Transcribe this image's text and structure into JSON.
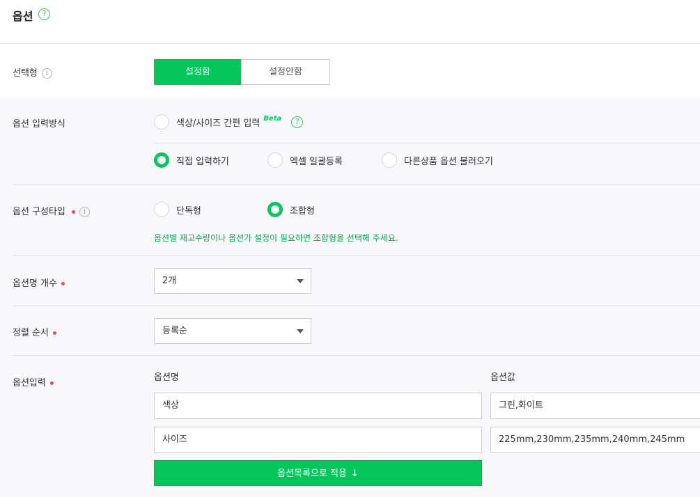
{
  "header": {
    "title": "옵션",
    "help_glyph": "?"
  },
  "selection_type": {
    "label": "선택형",
    "info_glyph": "i",
    "options": [
      "설정함",
      "설정안함"
    ],
    "selected": "설정함"
  },
  "input_method": {
    "label": "옵션 입력방식",
    "simple": {
      "label": "색상/사이즈 간편 입력",
      "badge": "Beta",
      "help_glyph": "?"
    },
    "options": [
      {
        "label": "직접 입력하기",
        "selected": true
      },
      {
        "label": "엑셀 일괄등록",
        "selected": false
      },
      {
        "label": "다른상품 옵션 불러오기",
        "selected": false
      }
    ]
  },
  "config_type": {
    "label": "옵션 구성타입",
    "info_glyph": "i",
    "options": [
      {
        "label": "단독형",
        "selected": false
      },
      {
        "label": "조합형",
        "selected": true
      }
    ],
    "hint": "옵션별 재고수량이나 옵션가 설정이 필요하면 조합형을 선택해 주세요."
  },
  "option_count": {
    "label": "옵션명 개수",
    "value": "2개"
  },
  "sort_order": {
    "label": "정렬 순서",
    "value": "등록순"
  },
  "option_input": {
    "label": "옵션입력",
    "name_header": "옵션명",
    "value_header": "옵션값",
    "rows": [
      {
        "name": "색상",
        "value": "그린,화이트"
      },
      {
        "name": "사이즈",
        "value": "225mm,230mm,235mm,240mm,245mm"
      }
    ],
    "apply_label": "옵션목록으로 적용",
    "apply_icon": "↓"
  },
  "colors": {
    "accent": "#03c75a",
    "required_dot": "#f04d4d",
    "hint_text": "#03a94c"
  }
}
